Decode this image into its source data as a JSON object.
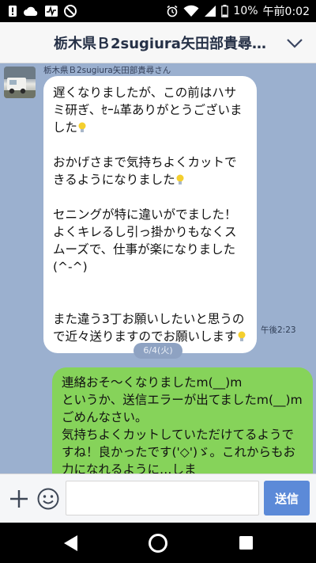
{
  "status_bar": {
    "battery": "10%",
    "clock": "午前0:02",
    "icons": [
      "alert-icon",
      "cloud-icon",
      "activity-icon",
      "no-sound-icon",
      "alarm-icon",
      "wifi-icon",
      "signal-icon",
      "battery-icon"
    ]
  },
  "header": {
    "title": "栃木県Ｂ2sugiura矢田部貴尋さん",
    "chevron_icon": "chevron-down-icon"
  },
  "messages": {
    "incoming": {
      "sender": "栃木県Ｂ2sugiura矢田部貴尋さん",
      "time": "午後2:23",
      "paragraphs": [
        "遅くなりましたが、この前はハサミ研ぎ、ｾｰﾑ革ありがとうございました",
        "おかげさまで気持ちよくカットできるようになりました",
        "セニングが特に違いがでました！よくキレるし引っ掛かりもなくスムーズで、仕事が楽になりました(^-^)",
        "また違う3丁お願いしたいと思うので近々送りますのでお願いします"
      ]
    },
    "date_separator": "6/4(火)",
    "outgoing": {
      "lines": [
        "連絡おそ〜くなりましたm(__)m",
        "というか、送信エラーが出てましたm(__)m",
        "ごめんなさい。",
        "気持ちよくカットしていただけてるようですね！良かったです('◇')ゞ。これからもお力になれるように…しま"
      ]
    }
  },
  "input_bar": {
    "placeholder": "",
    "send_label": "送信"
  },
  "colors": {
    "chat_background": "#9bb0cf",
    "outgoing_bubble": "#86d35a",
    "send_button": "#5c8ad8"
  }
}
